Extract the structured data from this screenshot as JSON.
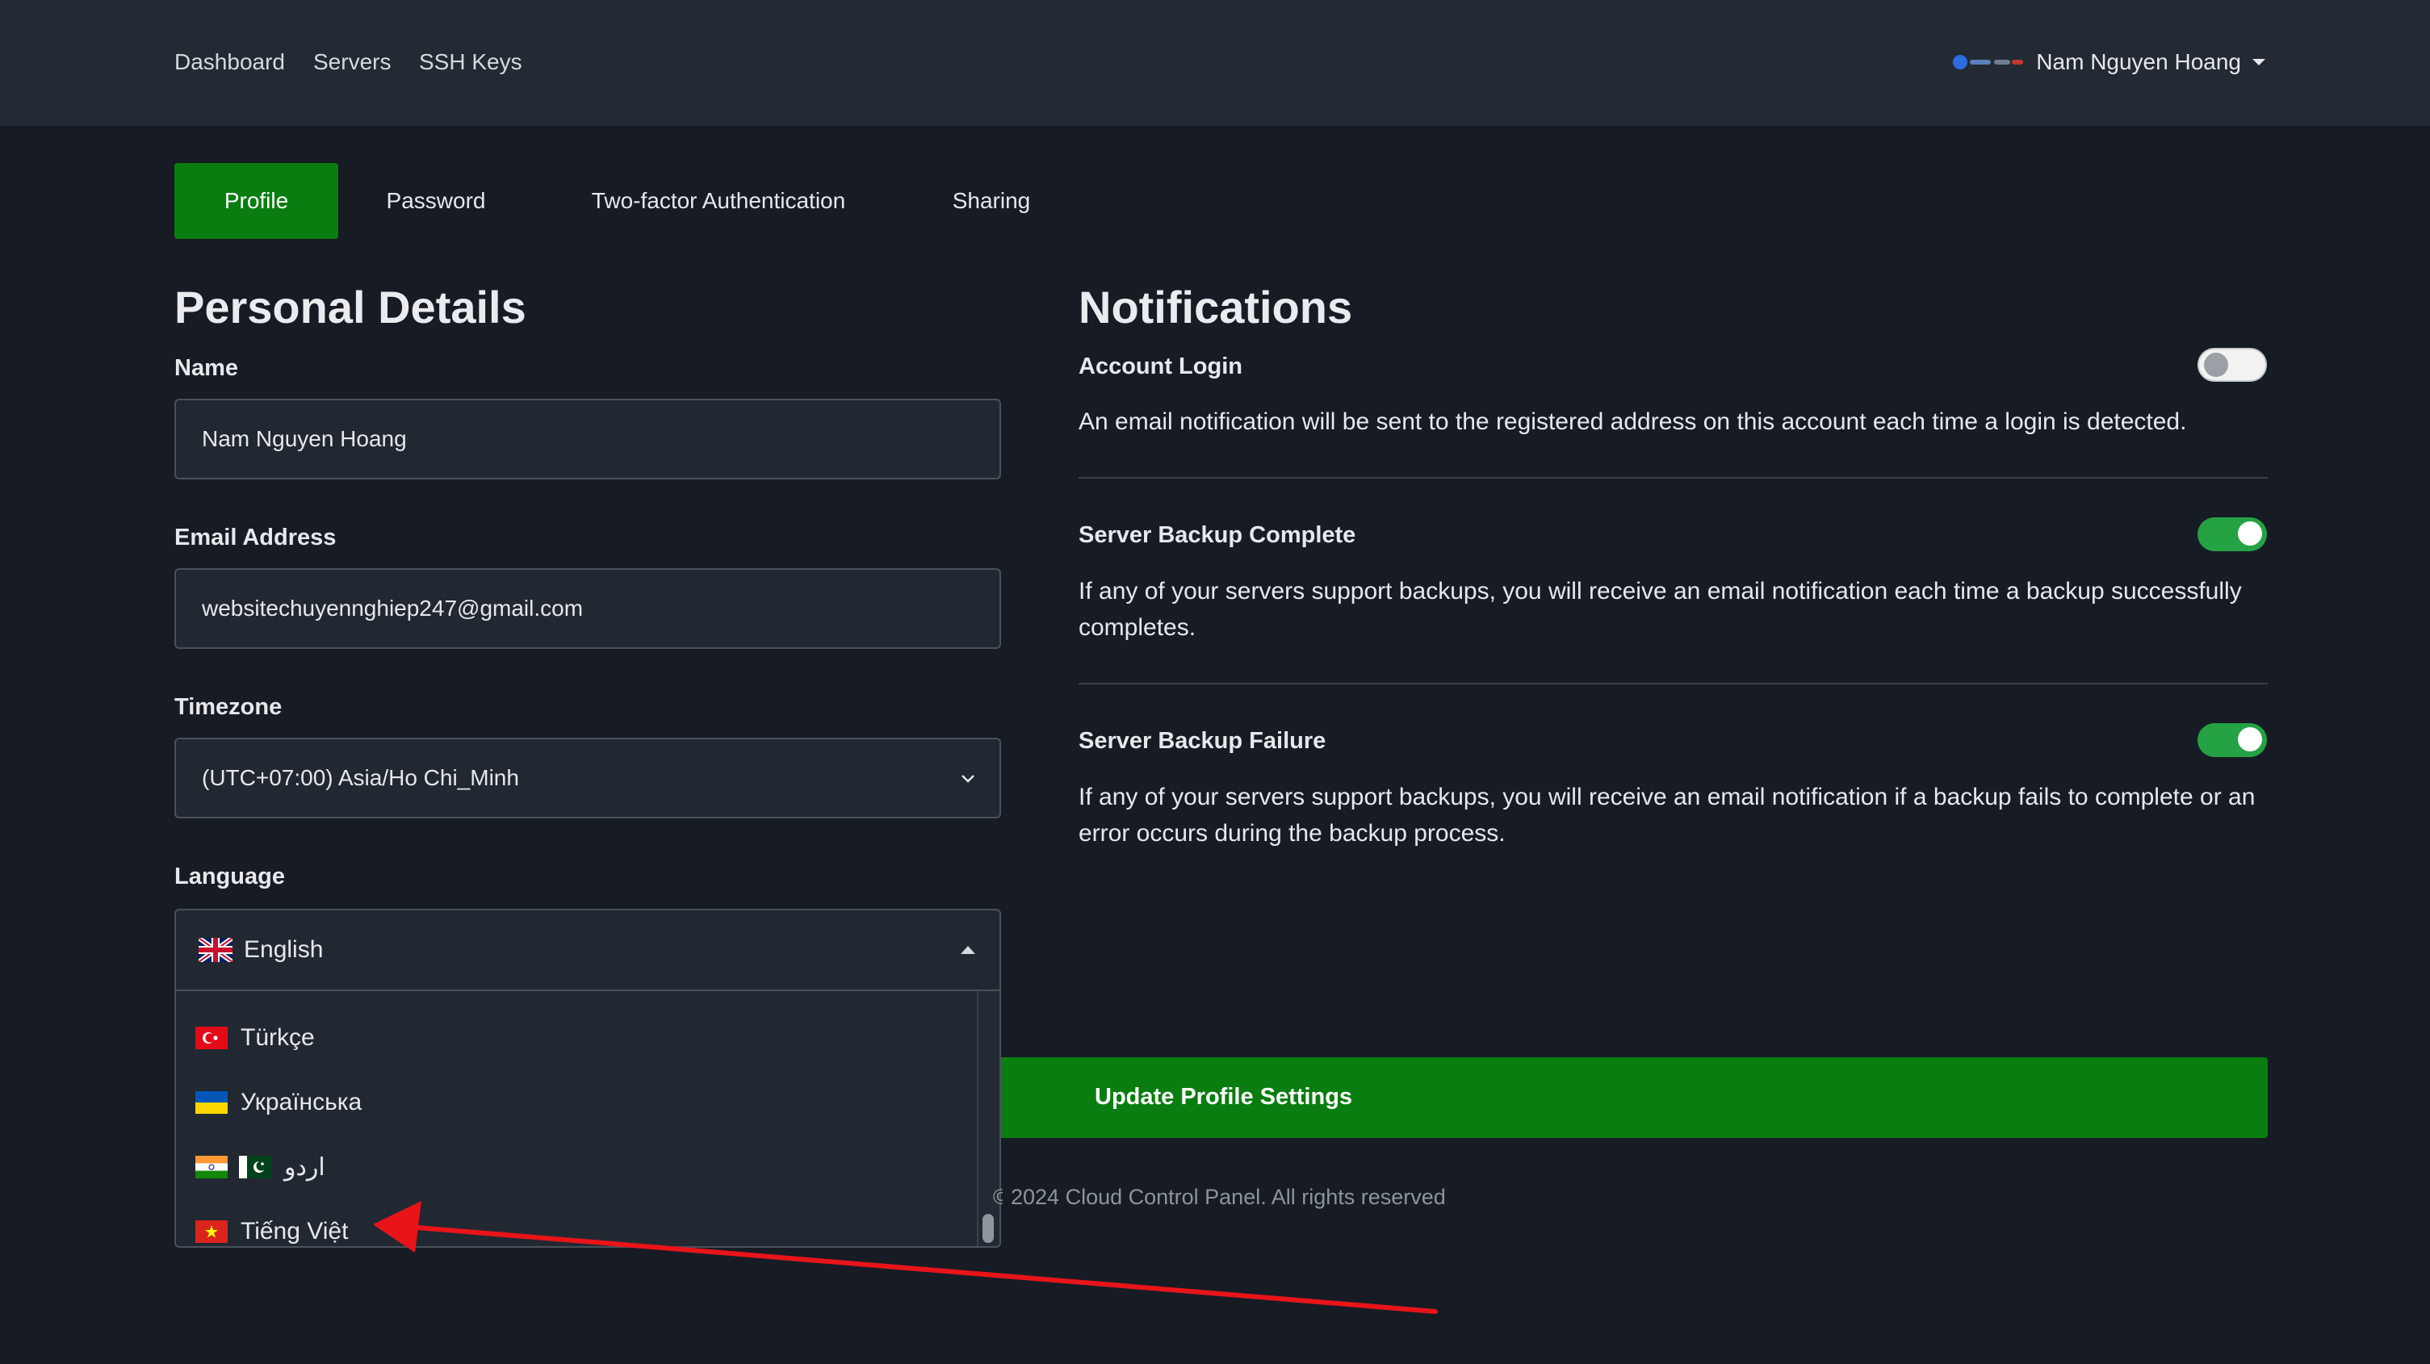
{
  "topbar": {
    "nav": [
      "Dashboard",
      "Servers",
      "SSH Keys"
    ],
    "user_name": "Nam Nguyen Hoang"
  },
  "tabs": [
    "Profile",
    "Password",
    "Two-factor Authentication",
    "Sharing"
  ],
  "personal": {
    "title": "Personal Details",
    "name_label": "Name",
    "name_value": "Nam Nguyen Hoang",
    "email_label": "Email Address",
    "email_value": "websitechuyennghiep247@gmail.com",
    "timezone_label": "Timezone",
    "timezone_value": "(UTC+07:00) Asia/Ho Chi_Minh",
    "language_label": "Language",
    "language_selected": "English",
    "language_options": [
      "Türkçe",
      "Українська",
      "اردو",
      "Tiếng Việt"
    ]
  },
  "notifications": {
    "title": "Notifications",
    "items": [
      {
        "title": "Account Login",
        "desc": "An email notification will be sent to the registered address on this account each time a login is detected.",
        "enabled": false
      },
      {
        "title": "Server Backup Complete",
        "desc": "If any of your servers support backups, you will receive an email notification each time a backup successfully completes.",
        "enabled": true
      },
      {
        "title": "Server Backup Failure",
        "desc": "If any of your servers support backups, you will receive an email notification if a backup fails to complete or an error occurs during the backup process.",
        "enabled": true
      }
    ]
  },
  "actions": {
    "update_label": "Update Profile Settings"
  },
  "footer": {
    "text": "2024 Cloud Control Panel. All rights reserved"
  },
  "colors": {
    "accent_green": "#0a7d10",
    "toggle_on": "#24a244",
    "annotation_red": "#e8141a"
  }
}
